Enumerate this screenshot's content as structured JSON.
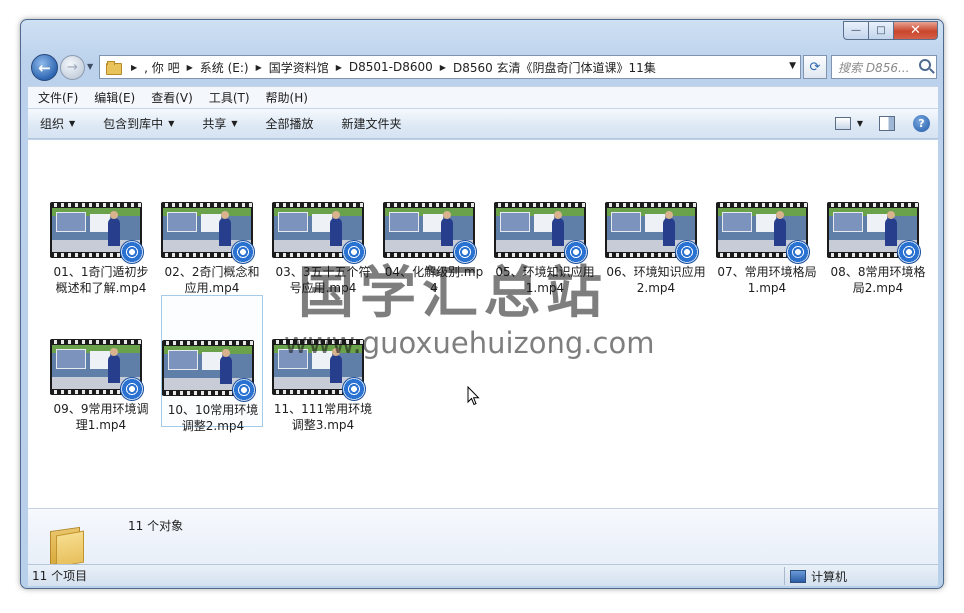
{
  "window": {
    "controls": {
      "minimize": "—",
      "maximize": "□",
      "close": "✕"
    }
  },
  "nav": {
    "breadcrumbs": [
      ", 你    吧",
      "系统 (E:)",
      "国学资料馆",
      "D8501-D8600",
      "D8560 玄清《阴盘奇门体道课》11集"
    ],
    "search_placeholder": "搜索 D856..."
  },
  "menu": [
    "文件(F)",
    "编辑(E)",
    "查看(V)",
    "工具(T)",
    "帮助(H)"
  ],
  "toolbar": {
    "organize": "组织",
    "include_library": "包含到库中",
    "share": "共享",
    "play_all": "全部播放",
    "new_folder": "新建文件夹"
  },
  "files": [
    {
      "name": "01、1奇门遁初步概述和了解.mp4",
      "selected": false
    },
    {
      "name": "02、2奇门概念和应用.mp4",
      "selected": false
    },
    {
      "name": "03、3五十五个符号应用.mp4",
      "selected": false
    },
    {
      "name": "04、化解级别.mp4",
      "selected": false
    },
    {
      "name": "05、环境知识应用1.mp4",
      "selected": false
    },
    {
      "name": "06、环境知识应用2.mp4",
      "selected": false
    },
    {
      "name": "07、常用环境格局1.mp4",
      "selected": false
    },
    {
      "name": "08、8常用环境格局2.mp4",
      "selected": false
    },
    {
      "name": "09、9常用环境调理1.mp4",
      "selected": false
    },
    {
      "name": "10、10常用环境调整2.mp4",
      "selected": true
    },
    {
      "name": "11、111常用环境调整3.mp4",
      "selected": false
    }
  ],
  "watermark": {
    "line1": "国学汇总站",
    "line2": "www.guoxuehuizong.com"
  },
  "details": {
    "count": "11 个对象"
  },
  "status": {
    "items": "11 个项目",
    "location": "计算机"
  },
  "icons": {
    "back": "back-arrow-icon",
    "forward": "forward-arrow-icon",
    "refresh": "refresh-icon",
    "search": "search-icon",
    "help": "help-icon",
    "video": "video-film-icon"
  }
}
